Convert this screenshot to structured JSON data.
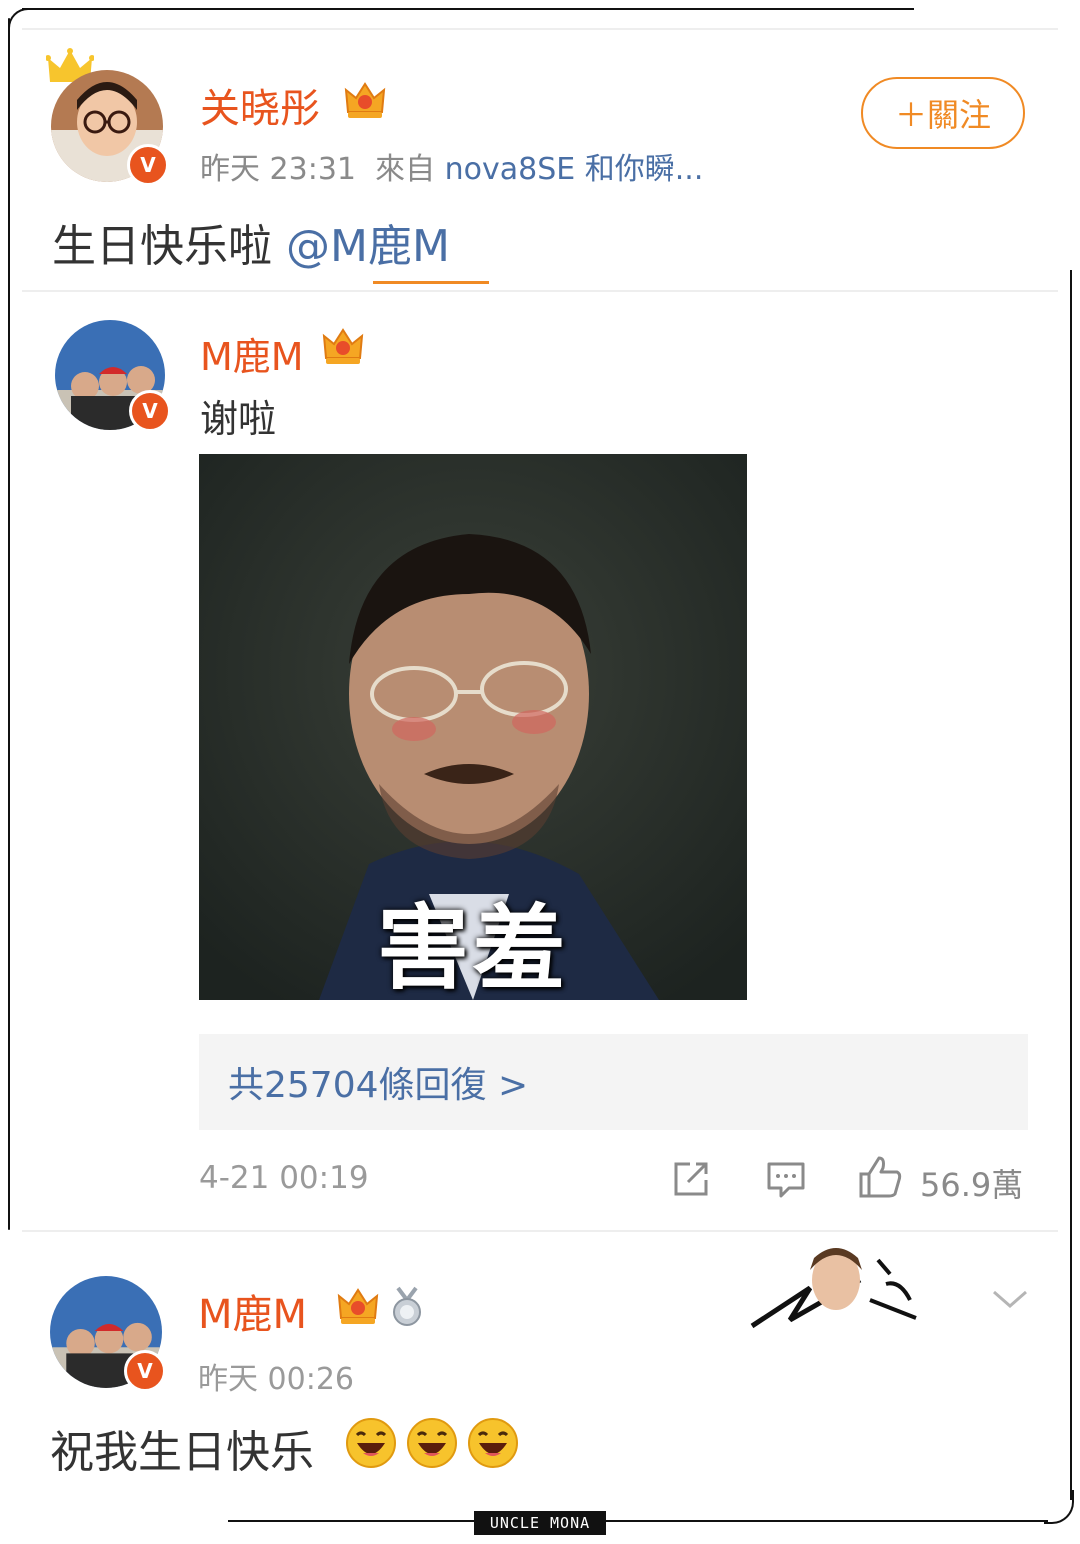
{
  "post": {
    "author": "关晓彤",
    "time": "昨天 23:31",
    "source_prefix": "來自",
    "source": "nova8SE 和你瞬...",
    "text": "生日快乐啦",
    "mention": "@M鹿M",
    "follow_label": "＋關注"
  },
  "reply": {
    "author": "M鹿M",
    "text": "谢啦",
    "image_caption": "害羞",
    "replies_label": "共25704條回復 >",
    "time": "4-21 00:19",
    "likes": "56.9萬"
  },
  "comment2": {
    "author": "M鹿M",
    "time": "昨天 00:26",
    "text": "祝我生日快乐"
  },
  "watermark": "UNCLE MONA",
  "colors": {
    "accent": "#e8541e",
    "link": "#4a6fa5",
    "follow": "#f08a24"
  },
  "icons": [
    "crown-icon",
    "verified-icon",
    "vip-crown-icon",
    "share-icon",
    "comment-icon",
    "like-icon",
    "medal-icon",
    "chevron-down-icon",
    "laugh-emoji-icon"
  ]
}
